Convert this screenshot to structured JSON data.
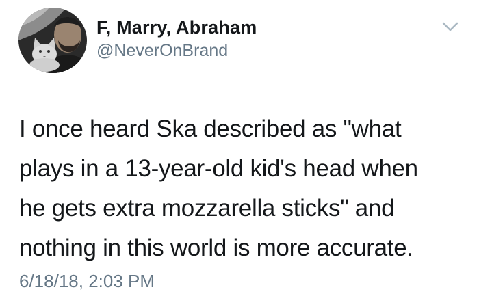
{
  "author": {
    "display_name": "F, Marry, Abraham",
    "handle": "@NeverOnBrand"
  },
  "tweet": {
    "lines": [
      "I once heard Ska described as \"what",
      "plays in a 13-year-old kid's head when",
      "he gets extra mozzarella sticks\" and",
      "nothing in this world is more accurate."
    ],
    "timestamp": "6/18/18, 2:03 PM"
  },
  "icons": {
    "avatar": "profile-photo-man-with-cat",
    "menu": "chevron-down-icon"
  },
  "colors": {
    "text_primary": "#14171a",
    "text_secondary": "#657786",
    "icon_muted": "#aab8c2",
    "background": "#ffffff"
  }
}
